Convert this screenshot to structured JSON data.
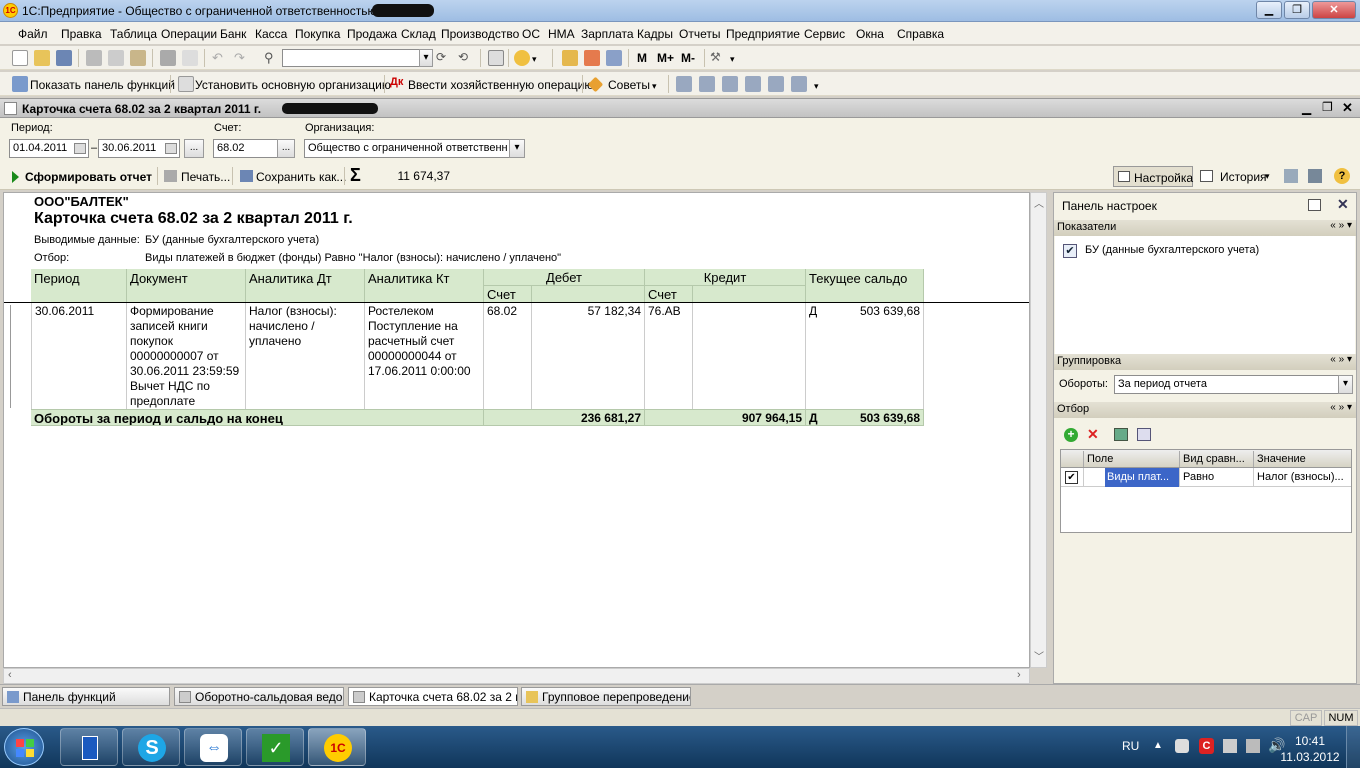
{
  "window": {
    "title": "1С:Предприятие - Общество с ограниченной ответственностью"
  },
  "menu": [
    "Файл",
    "Правка",
    "Таблица",
    "Операции",
    "Банк",
    "Касса",
    "Покупка",
    "Продажа",
    "Склад",
    "Производство",
    "ОС",
    "НМА",
    "Зарплата",
    "Кадры",
    "Отчеты",
    "Предприятие",
    "Сервис",
    "Окна",
    "Справка"
  ],
  "toolbar2": {
    "show_panel": "Показать панель функций",
    "set_org": "Установить основную организацию",
    "enter_op": "Ввести хозяйственную операцию",
    "tips": "Советы",
    "m": "M",
    "mplus": "M+",
    "mminus": "M-"
  },
  "doc": {
    "title": "Карточка счета 68.02 за 2 квартал 2011 г."
  },
  "params": {
    "period_label": "Период:",
    "date_from": "01.04.2011",
    "dash": "–",
    "date_to": "30.06.2011",
    "ellipsis": "...",
    "account_label": "Счет:",
    "account": "68.02",
    "org_label": "Организация:",
    "org": "Общество с ограниченной ответственн"
  },
  "cmd": {
    "generate": "Сформировать отчет",
    "print": "Печать...",
    "save_as": "Сохранить как...",
    "sigma": "Σ",
    "sum": "11 674,37",
    "settings": "Настройка",
    "history": "История"
  },
  "report": {
    "company": "ООО\"БАЛТЕК\"",
    "title": "Карточка счета 68.02 за 2 квартал 2011 г.",
    "data_label": "Выводимые данные:",
    "data_value": "БУ (данные бухгалтерского учета)",
    "filter_label": "Отбор:",
    "filter_value": "Виды платежей в бюджет (фонды) Равно \"Налог (взносы): начислено / уплачено\"",
    "headers": {
      "period": "Период",
      "document": "Документ",
      "an_dt": "Аналитика Дт",
      "an_kt": "Аналитика Кт",
      "debit": "Дебет",
      "credit": "Кредит",
      "balance": "Текущее сальдо",
      "account": "Счет",
      "account2": "Счет"
    },
    "row": {
      "period": "30.06.2011",
      "document": "Формирование записей книги покупок 00000000007 от 30.06.2011 23:59:59 Вычет НДС по предоплате",
      "an_dt": "Налог (взносы): начислено / уплачено",
      "an_kt": "Ростелеком Поступление на расчетный счет 00000000044 от 17.06.2011 0:00:00",
      "dt_acc": "68.02",
      "dt_sum": "57 182,34",
      "kt_acc": "76.АВ",
      "kt_sum": "",
      "bal_side": "Д",
      "bal_sum": "503 639,68"
    },
    "total": {
      "label": "Обороты за период и сальдо на конец",
      "debit": "236 681,27",
      "credit": "907 964,15",
      "bal_side": "Д",
      "bal_sum": "503 639,68"
    }
  },
  "panel": {
    "title": "Панель настроек",
    "indicators_label": "Показатели",
    "indicator": "БУ (данные бухгалтерского учета)",
    "grouping_label": "Группировка",
    "turnover_label": "Обороты:",
    "turnover_value": "За период отчета",
    "filter_label": "Отбор",
    "cols": {
      "field": "Поле",
      "cmp": "Вид сравн...",
      "value": "Значение"
    },
    "filter_row": {
      "field": "Виды плат...",
      "cmp": "Равно",
      "value": "Налог (взносы)..."
    }
  },
  "tabs": [
    "Панель функций",
    "Оборотно-сальдовая ведом...",
    "Карточка счета 68.02 за 2 к...",
    "Групповое перепроведение..."
  ],
  "status": {
    "cap": "CAP",
    "num": "NUM"
  },
  "tray": {
    "lang": "RU",
    "time": "10:41",
    "date": "11.03.2012"
  },
  "colors": {
    "header_green": "#d7e9cd",
    "accent": "#2a5a8a"
  }
}
